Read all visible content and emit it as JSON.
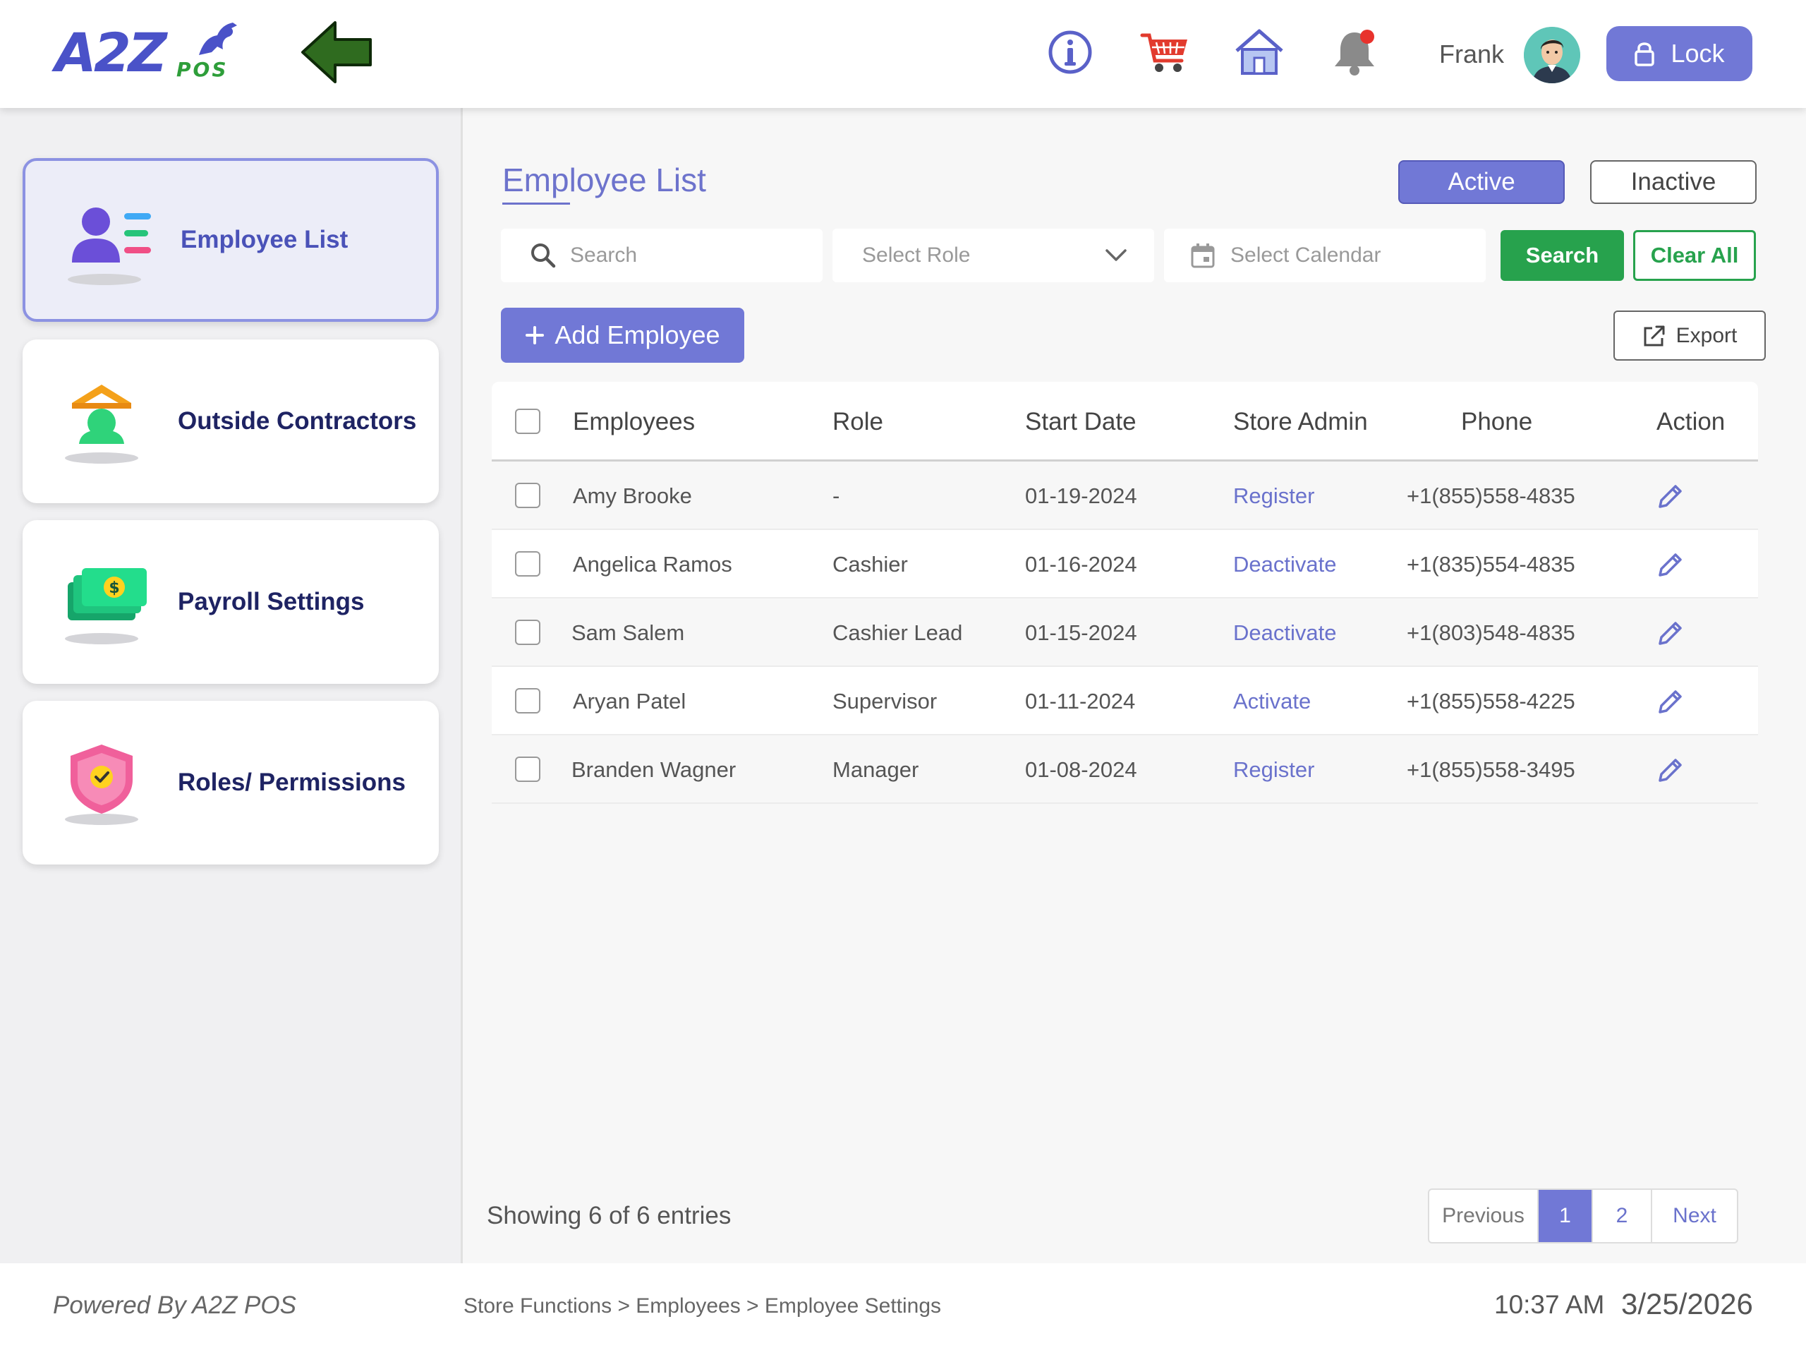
{
  "header": {
    "logo_text": "A2Z",
    "logo_sub": "POS",
    "user_name": "Frank",
    "lock_label": "Lock"
  },
  "sidebar": {
    "items": [
      {
        "label": "Employee List",
        "icon": "employee-list-icon",
        "active": true
      },
      {
        "label": "Outside Contractors",
        "icon": "contractor-icon",
        "active": false
      },
      {
        "label": "Payroll Settings",
        "icon": "money-icon",
        "active": false
      },
      {
        "label": "Roles/ Permissions",
        "icon": "shield-icon",
        "active": false
      }
    ]
  },
  "main": {
    "title": "Employee List",
    "status_toggle": {
      "active": "Active",
      "inactive": "Inactive",
      "selected": "Active"
    },
    "filters": {
      "search_placeholder": "Search",
      "role_placeholder": "Select Role",
      "calendar_placeholder": "Select Calendar",
      "search_button": "Search",
      "clear_button": "Clear All"
    },
    "add_button": "Add Employee",
    "export_button": "Export",
    "table": {
      "columns": [
        "Employees",
        "Role",
        "Start Date",
        "Store Admin",
        "Phone",
        "Action"
      ],
      "rows": [
        {
          "name": "Amy Brooke",
          "role": "-",
          "start_date": "01-19-2024",
          "store_admin": "Register",
          "phone": "+1(855)558-4835"
        },
        {
          "name": "Angelica Ramos",
          "role": "Cashier",
          "start_date": "01-16-2024",
          "store_admin": "Deactivate",
          "phone": "+1(835)554-4835"
        },
        {
          "name": "Sam Salem",
          "role": "Cashier Lead",
          "start_date": "01-15-2024",
          "store_admin": "Deactivate",
          "phone": "+1(803)548-4835"
        },
        {
          "name": "Aryan Patel",
          "role": "Supervisor",
          "start_date": "01-11-2024",
          "store_admin": "Activate",
          "phone": "+1(855)558-4225"
        },
        {
          "name": "Branden Wagner",
          "role": "Manager",
          "start_date": "01-08-2024",
          "store_admin": "Register",
          "phone": "+1(855)558-3495"
        }
      ]
    },
    "showing_text": "Showing 6 of 6 entries",
    "pagination": {
      "previous": "Previous",
      "pages": [
        "1",
        "2"
      ],
      "current": "1",
      "next": "Next"
    }
  },
  "footer": {
    "powered_by": "Powered By A2Z POS",
    "breadcrumb": "Store Functions > Employees > Employee Settings",
    "time": "10:37 AM",
    "date": "3/25/2026"
  },
  "colors": {
    "accent": "#7178d6",
    "green": "#27a24d",
    "link": "#6a72cc"
  }
}
